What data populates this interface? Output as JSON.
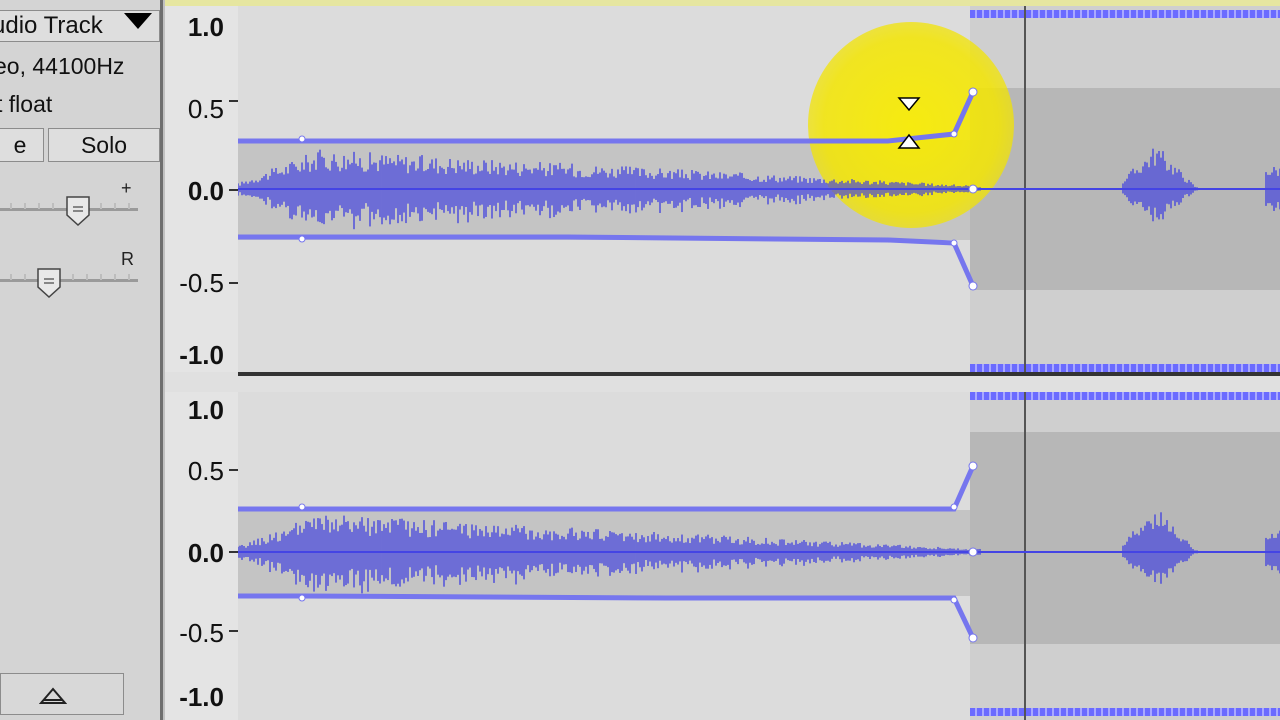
{
  "track": {
    "name": "udio Track",
    "format": "eo, 44100Hz",
    "bitdepth": "t float",
    "mute_label": "e",
    "solo_label": "Solo",
    "gain_plus": "+",
    "pan_right": "R"
  },
  "ruler": {
    "labels": [
      "1.0",
      "0.5",
      "0.0",
      "-0.5",
      "-1.0"
    ]
  },
  "colors": {
    "waveform": "#3f3fe0",
    "envelope": "#7676ee",
    "highlight": "#f4e600"
  },
  "icons": {
    "dropdown": "triangle-down-icon",
    "collapse": "triangle-up-icon",
    "envelope_handle": "double-triangle-icon"
  }
}
